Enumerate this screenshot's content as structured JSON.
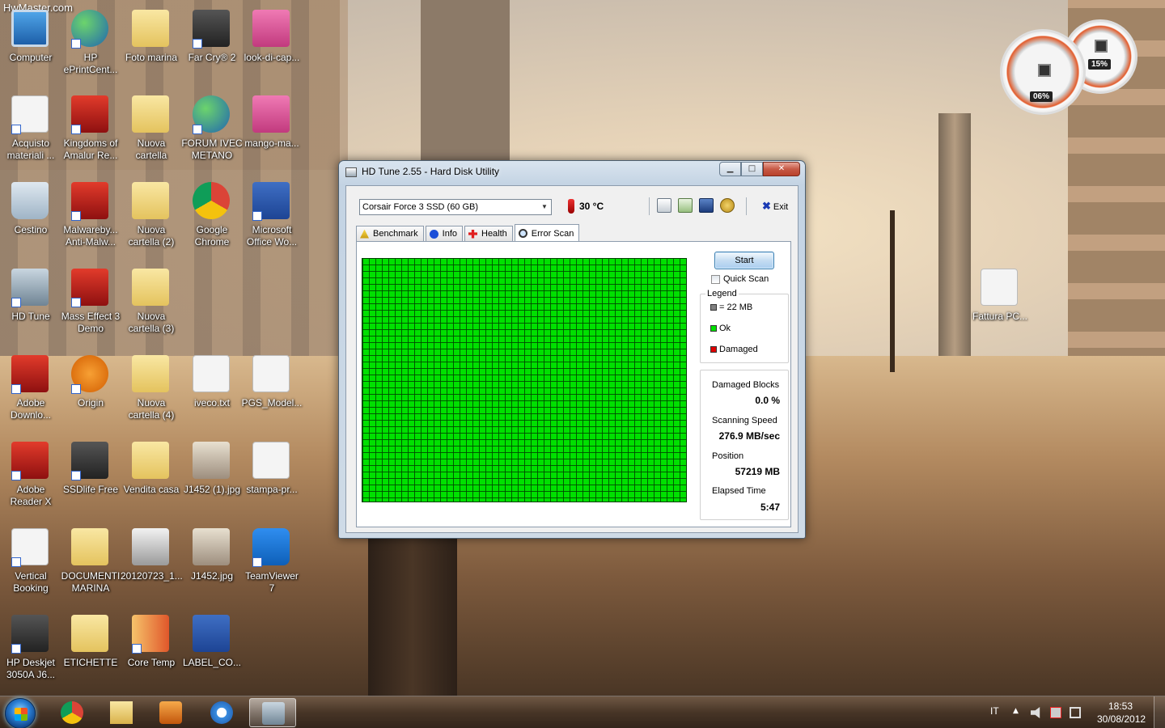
{
  "watermark": "HwMaster.com",
  "desktop_icons": [
    {
      "label": "Computer"
    },
    {
      "label": "HP\nePrintCent..."
    },
    {
      "label": "Foto marina"
    },
    {
      "label": "Far Cry® 2"
    },
    {
      "label": "look-di-cap..."
    },
    {
      "label": "Acquisto\nmateriali ..."
    },
    {
      "label": "Kingdoms of\nAmalur Re..."
    },
    {
      "label": "Nuova\ncartella"
    },
    {
      "label": "FORUM IVEC\nMETANO"
    },
    {
      "label": "mango-ma..."
    },
    {
      "label": "Cestino"
    },
    {
      "label": "Malwareby...\nAnti-Malw..."
    },
    {
      "label": "Nuova\ncartella (2)"
    },
    {
      "label": "Google\nChrome"
    },
    {
      "label": "Microsoft\nOffice Wo..."
    },
    {
      "label": "HD Tune"
    },
    {
      "label": "Mass Effect 3\nDemo"
    },
    {
      "label": "Nuova\ncartella (3)"
    },
    {
      "label": "Adobe\nDownlo..."
    },
    {
      "label": "Origin"
    },
    {
      "label": "Nuova\ncartella (4)"
    },
    {
      "label": "iveco.txt"
    },
    {
      "label": "PGS_Model..."
    },
    {
      "label": "Adobe\nReader X"
    },
    {
      "label": "SSDlife Free"
    },
    {
      "label": "Vendita casa"
    },
    {
      "label": "J1452 (1).jpg"
    },
    {
      "label": "stampa-pr..."
    },
    {
      "label": "Vertical\nBooking"
    },
    {
      "label": "DOCUMENTI\nMARINA"
    },
    {
      "label": "20120723_1..."
    },
    {
      "label": "J1452.jpg"
    },
    {
      "label": "TeamViewer\n7"
    },
    {
      "label": "HP Deskjet\n3050A J6..."
    },
    {
      "label": "ETICHETTE"
    },
    {
      "label": "Core Temp"
    },
    {
      "label": "LABEL_CO..."
    },
    {
      "label": "Fattura PC..."
    }
  ],
  "gadget": {
    "disk_percent": "06%",
    "cpu_percent": "15%",
    "accent": "#e35b2a"
  },
  "window": {
    "title": "HD Tune 2.55 - Hard Disk Utility",
    "caption": {
      "minimize": "▁",
      "maximize": "□",
      "close": "✕"
    },
    "drive": "Corsair Force 3 SSD (60 GB)",
    "temperature": "30 °C",
    "toolbar": {
      "copy_icon": "copy-icon",
      "copy_all_icon": "copy-all-icon",
      "save_icon": "save-icon",
      "options_icon": "options-icon",
      "exit_label": "Exit",
      "exit_glyph": "✖"
    },
    "tabs": [
      {
        "label": "Benchmark",
        "icon": "benchmark-icon"
      },
      {
        "label": "Info",
        "icon": "info-icon"
      },
      {
        "label": "Health",
        "icon": "health-icon"
      },
      {
        "label": "Error Scan",
        "icon": "error-scan-icon",
        "active": true
      }
    ],
    "error_scan": {
      "start_label": "Start",
      "quick_scan_label": "Quick Scan",
      "quick_scan_checked": false,
      "legend_title": "Legend",
      "legend": [
        {
          "label": "= 22 MB",
          "color": "#808080"
        },
        {
          "label": "Ok",
          "color": "#00e000"
        },
        {
          "label": "Damaged",
          "color": "#e00000"
        }
      ],
      "stats": [
        {
          "label": "Damaged Blocks",
          "value": "0.0 %"
        },
        {
          "label": "Scanning Speed",
          "value": "276.9 MB/sec"
        },
        {
          "label": "Position",
          "value": "57219 MB"
        },
        {
          "label": "Elapsed Time",
          "value": "5:47"
        }
      ],
      "grid_ok_color": "#00e000"
    }
  },
  "taskbar": {
    "items": [
      {
        "name": "chrome",
        "icon": "chrome-icon"
      },
      {
        "name": "explorer",
        "icon": "folder-icon"
      },
      {
        "name": "media-player",
        "icon": "media-player-icon"
      },
      {
        "name": "internet-explorer",
        "icon": "ie-icon"
      },
      {
        "name": "hd-tune",
        "icon": "hd-tune-icon",
        "active": true
      }
    ],
    "language": "IT",
    "time": "18:53",
    "date": "30/08/2012"
  }
}
